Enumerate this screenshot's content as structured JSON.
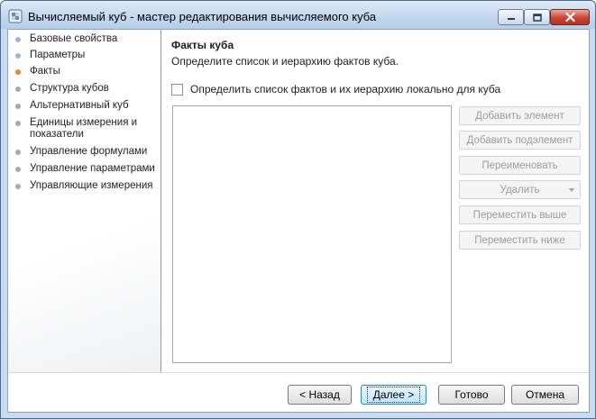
{
  "window": {
    "title": "Вычисляемый куб - мастер редактирования вычисляемого куба"
  },
  "colors": {
    "step_done": "#9fb5d6",
    "step_current": "#e8872b",
    "step_pending": "#a9a9a9"
  },
  "nav": {
    "items": [
      {
        "label": "Базовые свойства",
        "state": "done"
      },
      {
        "label": "Параметры",
        "state": "done"
      },
      {
        "label": "Факты",
        "state": "current"
      },
      {
        "label": "Структура кубов",
        "state": "pending"
      },
      {
        "label": "Альтернативный куб",
        "state": "pending"
      },
      {
        "label": "Единицы измерения и показатели",
        "state": "pending"
      },
      {
        "label": "Управление формулами",
        "state": "pending"
      },
      {
        "label": "Управление параметрами",
        "state": "pending"
      },
      {
        "label": "Управляющие измерения",
        "state": "pending"
      }
    ]
  },
  "page": {
    "title": "Факты куба",
    "description": "Определите список и иерархию фактов куба.",
    "checkbox_label": "Определить список фактов и их иерархию локально для куба",
    "checkbox_checked": false
  },
  "side_buttons": {
    "add_element": "Добавить элемент",
    "add_subelement": "Добавить подэлемент",
    "rename": "Переименовать",
    "delete": "Удалить",
    "move_up": "Переместить выше",
    "move_down": "Переместить ниже"
  },
  "footer": {
    "back": "< Назад",
    "next": "Далее >",
    "finish": "Готово",
    "cancel": "Отмена"
  }
}
